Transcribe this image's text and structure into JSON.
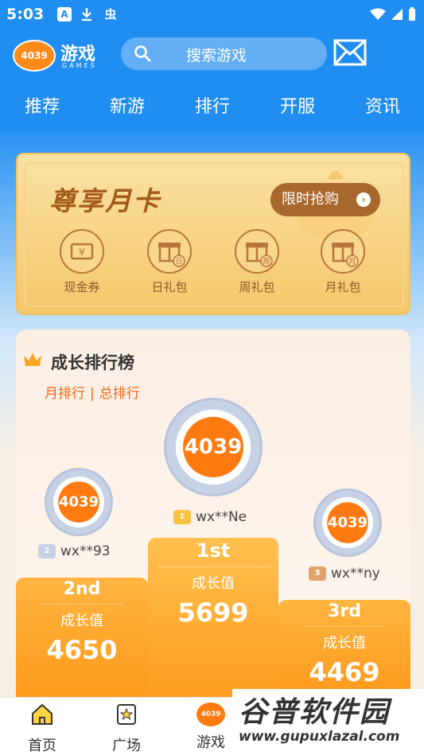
{
  "statusbar": {
    "time": "5:03",
    "icon_a": "A",
    "icon_bug": "虫"
  },
  "header": {
    "logo_badge": "4039",
    "logo_text": "游戏",
    "logo_sub": "GAMES",
    "search_placeholder": "搜索游戏"
  },
  "nav": {
    "items": [
      "推荐",
      "新游",
      "排行",
      "开服",
      "资讯"
    ]
  },
  "monthly_card": {
    "title": "尊享月卡",
    "buy_label": "限时抢购",
    "perks": [
      {
        "label": "现金券",
        "icon": "coupon-icon",
        "glyph": "¥"
      },
      {
        "label": "日礼包",
        "icon": "gift-day-icon",
        "glyph": "日"
      },
      {
        "label": "周礼包",
        "icon": "gift-week-icon",
        "glyph": "周"
      },
      {
        "label": "月礼包",
        "icon": "gift-month-icon",
        "glyph": "月"
      }
    ]
  },
  "ranking": {
    "title": "成长排行榜",
    "tab_month": "月排行",
    "tab_separator": "|",
    "tab_total": "总排行",
    "first": {
      "avatar": "4039",
      "medal": "1",
      "user": "wx**Ne",
      "place": "1st",
      "label": "成长值",
      "value": "5699"
    },
    "second": {
      "avatar": "4039",
      "medal": "2",
      "user": "wx**93",
      "place": "2nd",
      "label": "成长值",
      "value": "4650"
    },
    "third": {
      "avatar": "4039",
      "medal": "3",
      "user": "wx**ny",
      "place": "3rd",
      "label": "成长值",
      "value": "4469"
    }
  },
  "bottom_tabs": [
    {
      "label": "首页",
      "icon": "home-icon"
    },
    {
      "label": "广场",
      "icon": "square-icon"
    },
    {
      "label": "游戏",
      "icon": "game-icon",
      "badge": "4039"
    }
  ],
  "watermark": {
    "main": "谷普软件园",
    "sub": "www.gupuxlazal.com"
  },
  "colors": {
    "primary": "#1f8ef0",
    "accent": "#ff9a1c",
    "card_brown": "#a35a1a"
  }
}
